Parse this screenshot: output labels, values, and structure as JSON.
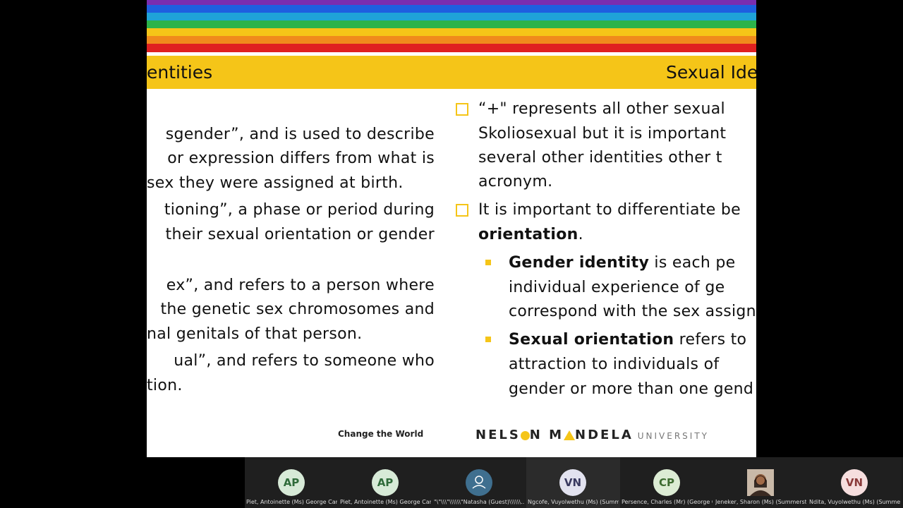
{
  "slide": {
    "title_left": "entities",
    "title_right": "Sexual Ide",
    "left_lines": [
      "sgender”, and is used to describe",
      "or expression differs from what is",
      "sex they were assigned at birth.",
      "tioning”, a phase or period during",
      " their sexual orientation or gender",
      "ex”, and refers to a person where",
      "the genetic sex chromosomes and",
      "nal genitals of that person.",
      "ual”, and refers to someone who",
      "tion."
    ],
    "right_bullets": [
      {
        "lines": [
          "“+\" represents all other sexual",
          "Skoliosexual but it is important",
          "several other identities other t",
          "acronym."
        ]
      },
      {
        "line1": "It is important to differentiate be",
        "line2_bold": "orientation",
        "line2_rest": "."
      }
    ],
    "sub_bullets": [
      {
        "bold": "Gender identity",
        "rest": " is each pe",
        "lines": [
          "individual experience of ge",
          "correspond with the sex assign"
        ]
      },
      {
        "bold": "Sexual orientation",
        "rest": " refers to",
        "lines": [
          "attraction to individuals of",
          "gender or more than one gend"
        ]
      }
    ],
    "footer_tagline": "Change the World",
    "logo": {
      "part1": "NELS",
      "part2": "N M",
      "part3": "NDELA",
      "university": "UNIVERSITY"
    },
    "stripe_colors": [
      "#7a2db0",
      "#1e5fe0",
      "#1fa3d8",
      "#2bb34a",
      "#f5c518",
      "#f08a1c",
      "#e02020"
    ]
  },
  "participants": [
    {
      "initials": "AP",
      "name": "Piet, Antoinette (Ms) George Campus",
      "bg": "#d7ead7",
      "fg": "#2f6b3a"
    },
    {
      "initials": "AP",
      "name": "Piet, Antoinette (Ms) George Campus",
      "bg": "#d7ead7",
      "fg": "#2f6b3a"
    },
    {
      "initials": "",
      "name": "\"\\\"\\\\\\\"\\\\\\\\\\\\\"Natasha  (Guest)\\\\\\\\\\\\...",
      "bg": "#3f6f8f",
      "fg": "#ffffff",
      "icon": "person-icon"
    },
    {
      "initials": "VN",
      "name": "Ngcofe, Vuyolwethu (Ms) (Summer...",
      "bg": "#e2e2ef",
      "fg": "#39395f"
    },
    {
      "initials": "CP",
      "name": "Persence, Charles (Mr) (George Ca...",
      "bg": "#dcecd4",
      "fg": "#3c6b2f"
    },
    {
      "initials": "",
      "name": "Jeneker, Sharon (Ms) (Summerstran...",
      "bg": "#6b4a3a",
      "fg": "#ffffff",
      "photo": true
    },
    {
      "initials": "VN",
      "name": "Ndita, Vuyolwethu (Ms) (Summerst...",
      "bg": "#f6dede",
      "fg": "#8a3a3a"
    }
  ]
}
